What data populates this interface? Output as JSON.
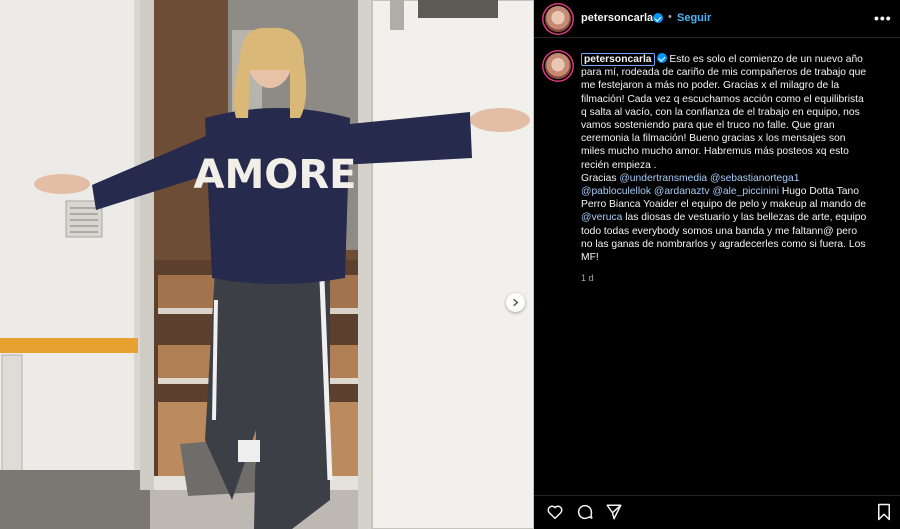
{
  "post": {
    "username": "petersoncarla",
    "follow_label": "Seguir",
    "separator": "•",
    "more_label": "•••",
    "photo_sweater_text": "AMORE",
    "caption_lines": [
      "Esto es solo el comienzo de un nuevo año",
      "para mí, rodeada de cariño de mis compañeros de trabajo que",
      "me festejaron a más no poder. Gracias x el milagro de la",
      "filmación! Cada vez q escuchamos acción como el equilibrista",
      "q salta al vacío, con la confianza de el trabajo en equipo, nos",
      "vamos sosteniendo para que el truco no falle. Que gran",
      "ceremonia la filmación! Bueno gracias x los mensajes son",
      "miles mucho mucho amor. Habremus más posteos xq esto",
      "recién empieza ."
    ],
    "thanks_label": "Gracias",
    "mentions": {
      "m1": "@undertransmedia",
      "m2": "@sebastianortega1",
      "m3": "@pabloculellok",
      "m4": "@ardanaztv",
      "m5": "@ale_piccinini",
      "m6": "@veruca"
    },
    "caption_tail": {
      "t1": "Hugo Dotta Tano",
      "t2": "Perro Bianca Yoaider el equipo de pelo y makeup al mando de",
      "t3": "las diosas de vestuario y las bellezas de arte, equipo",
      "t4": "todo todas everybody somos una banda y me faltann@ pero",
      "t5": "no las ganas de nombrarlos y agradecerles como si fuera. Los",
      "t6": "MF!"
    },
    "timestamp": "1 d"
  },
  "icons": {
    "verified": "verified-badge-icon",
    "more": "more-options-icon",
    "next": "chevron-right-icon",
    "like": "heart-icon",
    "comment": "comment-icon",
    "share": "send-icon",
    "save": "bookmark-icon"
  },
  "colors": {
    "background": "#000000",
    "text": "#f5f5f5",
    "link": "#4cb5f9",
    "mention": "#a6cdf8",
    "verified": "#0095f6",
    "muted": "#a8a8a8",
    "divider": "#262626"
  }
}
